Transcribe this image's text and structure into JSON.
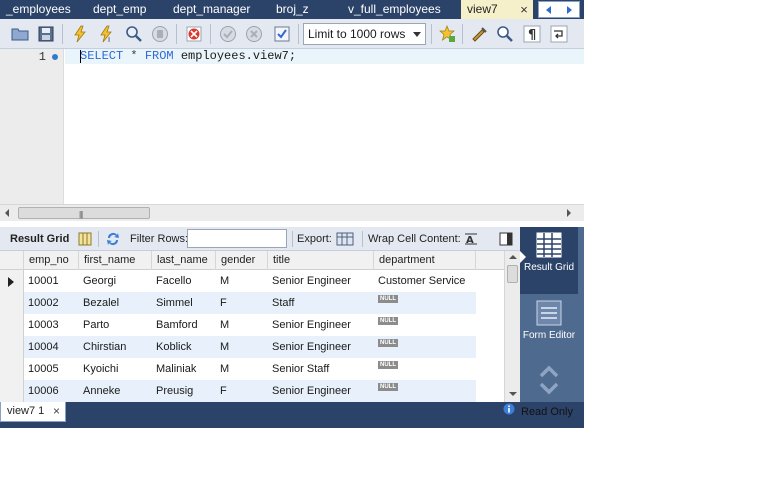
{
  "tabs": [
    {
      "label": "_employees",
      "active": false
    },
    {
      "label": "dept_emp",
      "active": false
    },
    {
      "label": "dept_manager",
      "active": false
    },
    {
      "label": "broj_z",
      "active": false
    },
    {
      "label": "v_full_employees",
      "active": false
    },
    {
      "label": "view7",
      "active": true
    }
  ],
  "tab_close": "×",
  "toolbar": {
    "limit_value": "Limit to 1000 rows",
    "icons": [
      "open-folder-icon",
      "save-icon",
      "execute-icon",
      "execute-current-icon",
      "explain-icon",
      "stop-icon",
      "toggle-error-icon",
      "commit-icon",
      "rollback-icon",
      "autocommit-icon",
      "beautify-icon",
      "find-icon",
      "invisible-chars-icon",
      "wrap-icon"
    ]
  },
  "editor": {
    "line_number": "1",
    "keyword_select": "SELECT",
    "star": "*",
    "keyword_from": "FROM",
    "table": "employees.view7;"
  },
  "result_toolbar": {
    "result_grid_label": "Result Grid",
    "filter_rows_label": "Filter Rows:",
    "filter_value": "",
    "export_label": "Export:",
    "wrap_label": "Wrap Cell Content:"
  },
  "grid": {
    "columns": [
      "emp_no",
      "first_name",
      "last_name",
      "gender",
      "title",
      "department"
    ],
    "rows": [
      [
        "10001",
        "Georgi",
        "Facello",
        "M",
        "Senior Engineer",
        "Customer Service"
      ],
      [
        "10002",
        "Bezalel",
        "Simmel",
        "F",
        "Staff",
        null
      ],
      [
        "10003",
        "Parto",
        "Bamford",
        "M",
        "Senior Engineer",
        null
      ],
      [
        "10004",
        "Chirstian",
        "Koblick",
        "M",
        "Senior Engineer",
        null
      ],
      [
        "10005",
        "Kyoichi",
        "Maliniak",
        "M",
        "Senior Staff",
        null
      ],
      [
        "10006",
        "Anneke",
        "Preusig",
        "F",
        "Senior Engineer",
        null
      ]
    ],
    "null_label": "NULL"
  },
  "side_panel": {
    "result_grid": "Result Grid",
    "form_editor": "Form Editor"
  },
  "bottom": {
    "result_tab_label": "view7 1",
    "close": "×",
    "status": "Read Only"
  },
  "colors": {
    "navy": "#2c4369",
    "active_tab": "#f5f0c9",
    "keyword": "#2f69d6",
    "alt_row": "#e8f1fb"
  }
}
